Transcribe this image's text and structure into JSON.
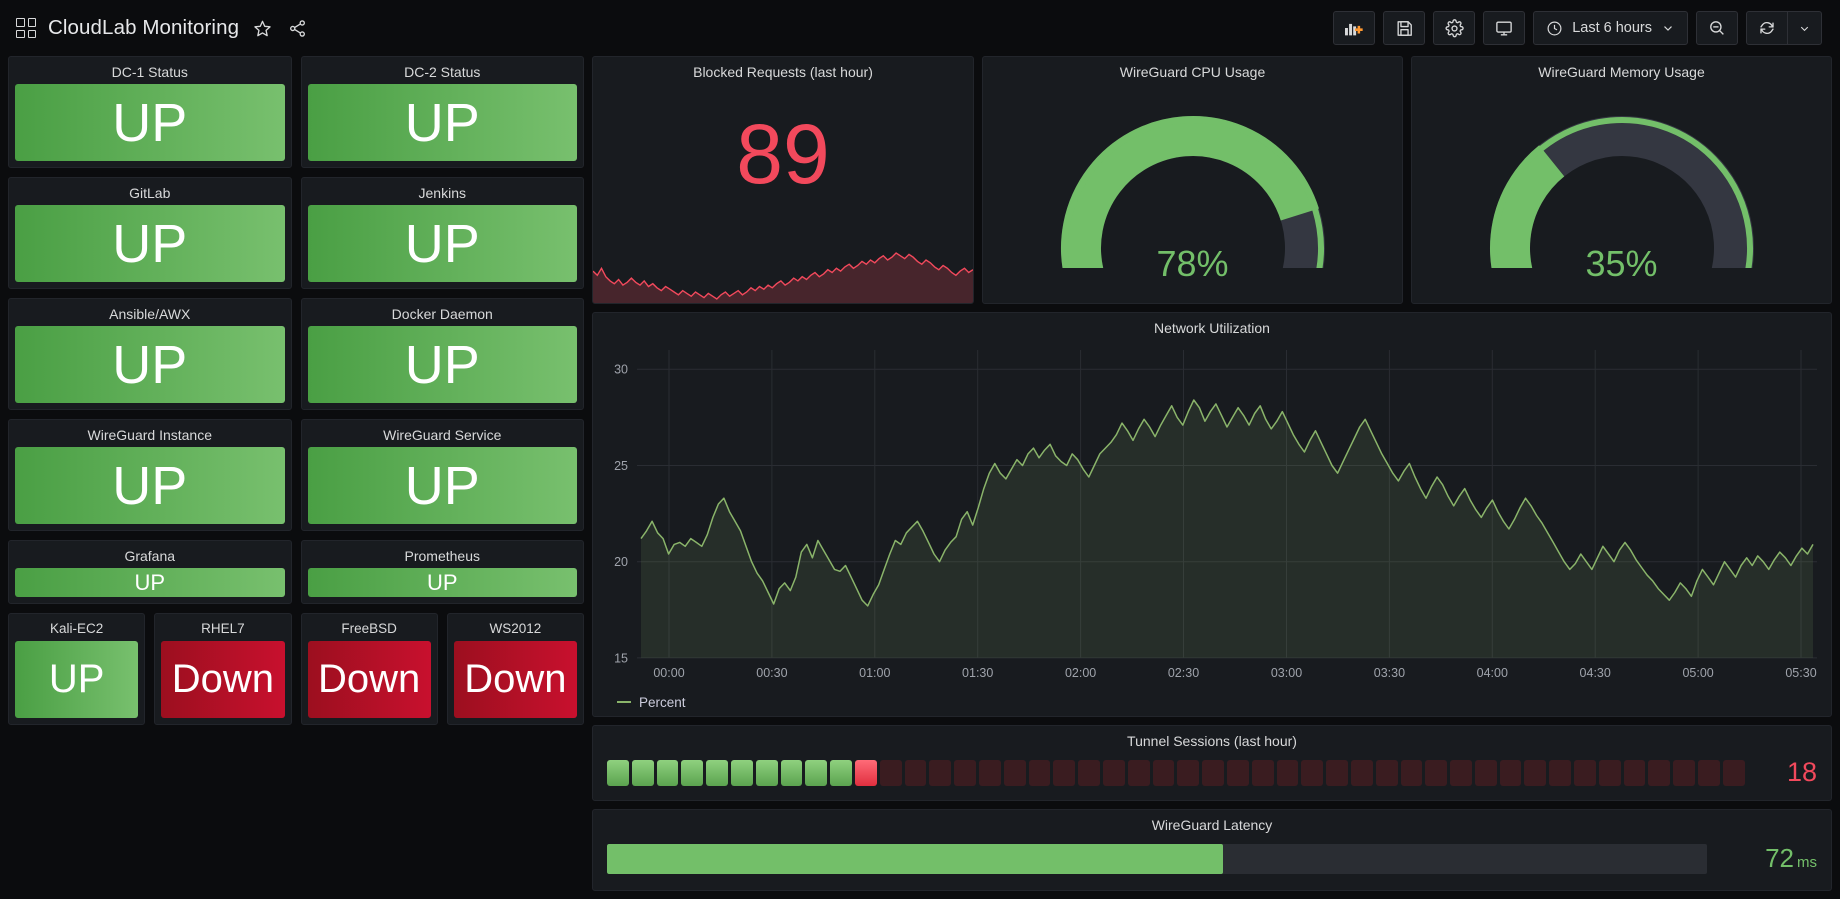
{
  "header": {
    "title": "CloudLab Monitoring",
    "grid_icon": "dashboard-grid-icon",
    "star_icon": "star-icon",
    "share_icon": "share-icon",
    "toolbar": {
      "add_panel_label": "add-panel",
      "save_label": "save-dashboard",
      "settings_label": "dashboard-settings",
      "tv_label": "cycle-view-mode",
      "time_range": "Last 6 hours",
      "zoom_out_label": "zoom-out-time-range",
      "refresh_label": "refresh-dashboard"
    }
  },
  "status_panels": {
    "rows": [
      {
        "size": "tall",
        "items": [
          {
            "title": "DC-1 Status",
            "value": "UP",
            "state": "up"
          },
          {
            "title": "DC-2 Status",
            "value": "UP",
            "state": "up"
          }
        ]
      },
      {
        "size": "tall",
        "items": [
          {
            "title": "GitLab",
            "value": "UP",
            "state": "up"
          },
          {
            "title": "Jenkins",
            "value": "UP",
            "state": "up"
          }
        ]
      },
      {
        "size": "tall",
        "items": [
          {
            "title": "Ansible/AWX",
            "value": "UP",
            "state": "up"
          },
          {
            "title": "Docker Daemon",
            "value": "UP",
            "state": "up"
          }
        ]
      },
      {
        "size": "tall",
        "items": [
          {
            "title": "WireGuard Instance",
            "value": "UP",
            "state": "up"
          },
          {
            "title": "WireGuard Service",
            "value": "UP",
            "state": "up"
          }
        ]
      },
      {
        "size": "short",
        "items": [
          {
            "title": "Grafana",
            "value": "UP",
            "state": "up"
          },
          {
            "title": "Prometheus",
            "value": "UP",
            "state": "up"
          }
        ]
      },
      {
        "size": "quad",
        "items": [
          {
            "title": "Kali-EC2",
            "value": "UP",
            "state": "up"
          },
          {
            "title": "RHEL7",
            "value": "Down",
            "state": "down"
          },
          {
            "title": "FreeBSD",
            "value": "Down",
            "state": "down"
          },
          {
            "title": "WS2012",
            "value": "Down",
            "state": "down"
          }
        ]
      }
    ]
  },
  "blocked_requests": {
    "title": "Blocked Requests (last hour)",
    "value": "89",
    "color": "#f2495c"
  },
  "gauges": [
    {
      "title": "WireGuard CPU Usage",
      "value": "78%",
      "percent": 78,
      "color": "#73bf69",
      "threshold_color": "#f2495c"
    },
    {
      "title": "WireGuard Memory Usage",
      "value": "35%",
      "percent": 35,
      "color": "#73bf69",
      "threshold_color": "#f2495c"
    }
  ],
  "network": {
    "title": "Network Utilization",
    "legend": "Percent"
  },
  "tunnel_sessions": {
    "title": "Tunnel Sessions (last hour)",
    "value": "18",
    "lit": 10,
    "alert_index": 10,
    "total": 46,
    "color": "#f2495c"
  },
  "latency": {
    "title": "WireGuard Latency",
    "value": "72",
    "unit": "ms",
    "percent": 56,
    "color": "#73bf69"
  },
  "chart_data": {
    "type": "line",
    "title": "Network Utilization",
    "xlabel": "",
    "ylabel": "Percent",
    "ylim": [
      15,
      31
    ],
    "yticks": [
      15,
      20,
      25,
      30
    ],
    "xticks": [
      "00:00",
      "00:30",
      "01:00",
      "01:30",
      "02:00",
      "02:30",
      "03:00",
      "03:30",
      "04:00",
      "04:30",
      "05:00",
      "05:30"
    ],
    "grid": true,
    "legend_position": "bottom-left",
    "series": [
      {
        "name": "Percent",
        "color": "#8ab46a",
        "fill": true,
        "values": [
          21.2,
          21.6,
          22.1,
          21.5,
          21.2,
          20.4,
          20.9,
          21.0,
          20.8,
          21.2,
          21.0,
          20.8,
          21.4,
          22.3,
          23.0,
          23.3,
          22.6,
          22.1,
          21.6,
          20.8,
          20.0,
          19.4,
          19.0,
          18.4,
          17.8,
          18.6,
          18.9,
          18.5,
          19.2,
          20.5,
          20.9,
          20.2,
          21.1,
          20.6,
          20.1,
          19.6,
          19.5,
          19.8,
          19.2,
          18.6,
          18.0,
          17.7,
          18.3,
          18.8,
          19.6,
          20.4,
          21.1,
          20.9,
          21.5,
          21.8,
          22.1,
          21.6,
          21.0,
          20.4,
          20.0,
          20.6,
          21.0,
          21.3,
          22.2,
          22.6,
          21.9,
          22.8,
          23.8,
          24.6,
          25.1,
          24.6,
          24.3,
          24.8,
          25.3,
          25.0,
          25.6,
          25.9,
          25.4,
          25.8,
          26.1,
          25.5,
          25.2,
          25.0,
          25.6,
          25.3,
          24.8,
          24.4,
          25.0,
          25.6,
          25.9,
          26.2,
          26.6,
          27.2,
          26.8,
          26.3,
          26.9,
          27.4,
          27.0,
          26.5,
          27.1,
          27.6,
          28.1,
          27.5,
          27.1,
          27.8,
          28.4,
          28.0,
          27.3,
          27.8,
          28.2,
          27.6,
          27.0,
          27.5,
          28.0,
          27.6,
          27.1,
          27.7,
          28.1,
          27.4,
          26.9,
          27.3,
          27.8,
          27.2,
          26.6,
          26.1,
          25.7,
          26.3,
          26.8,
          26.2,
          25.6,
          25.0,
          24.6,
          25.2,
          25.8,
          26.4,
          27.0,
          27.4,
          26.8,
          26.2,
          25.6,
          25.1,
          24.6,
          24.2,
          24.7,
          25.1,
          24.4,
          23.8,
          23.3,
          23.9,
          24.4,
          24.0,
          23.4,
          22.9,
          23.4,
          23.8,
          23.2,
          22.7,
          22.3,
          22.8,
          23.2,
          22.6,
          22.1,
          21.7,
          22.2,
          22.8,
          23.3,
          22.9,
          22.4,
          22.0,
          21.5,
          21.0,
          20.5,
          20.0,
          19.6,
          19.9,
          20.4,
          20.0,
          19.6,
          20.2,
          20.8,
          20.4,
          20.0,
          20.6,
          21.0,
          20.6,
          20.1,
          19.7,
          19.3,
          19.0,
          18.6,
          18.3,
          18.0,
          18.4,
          18.9,
          18.6,
          18.2,
          19.0,
          19.6,
          19.2,
          18.8,
          19.4,
          20.0,
          19.6,
          19.2,
          19.8,
          20.2,
          19.8,
          20.3,
          20.0,
          19.6,
          20.1,
          20.5,
          20.2,
          19.8,
          20.3,
          20.7,
          20.4,
          20.9
        ]
      }
    ]
  },
  "sparkline": {
    "color": "#f2495c",
    "values": [
      34,
      31,
      36,
      30,
      27,
      25,
      28,
      24,
      26,
      29,
      26,
      24,
      27,
      23,
      25,
      22,
      20,
      23,
      21,
      19,
      17,
      20,
      18,
      16,
      19,
      17,
      15,
      18,
      16,
      14,
      17,
      19,
      16,
      18,
      20,
      17,
      19,
      22,
      20,
      23,
      21,
      24,
      22,
      25,
      27,
      24,
      26,
      29,
      27,
      30,
      28,
      31,
      33,
      30,
      32,
      35,
      33,
      36,
      34,
      37,
      39,
      36,
      38,
      41,
      39,
      42,
      40,
      43,
      45,
      42,
      44,
      47,
      45,
      43,
      46,
      44,
      41,
      39,
      42,
      40,
      37,
      35,
      38,
      36,
      33,
      31,
      34,
      36,
      33,
      35
    ]
  }
}
